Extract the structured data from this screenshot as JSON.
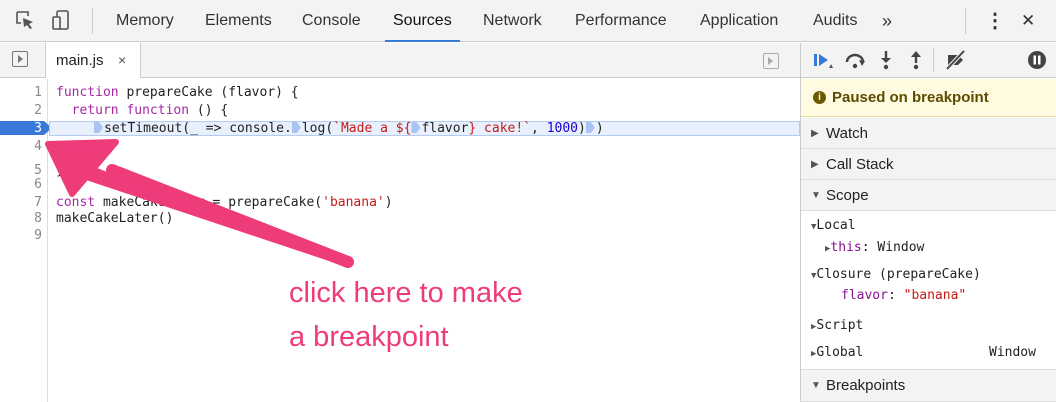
{
  "toolbar": {
    "tabs": [
      "Memory",
      "Elements",
      "Console",
      "Sources",
      "Network",
      "Performance",
      "Application",
      "Audits"
    ],
    "active_tab": "Sources",
    "overflow": "»",
    "kebab": "⋮",
    "close": "✕"
  },
  "editor": {
    "file_tab": {
      "name": "main.js",
      "close": "×"
    },
    "line_numbers": [
      "1",
      "2",
      "3",
      "4",
      "5",
      "6",
      "7",
      "8",
      "9"
    ],
    "breakpoint_line": 3,
    "code": {
      "l1_kw": "function",
      "l1_rest": " prepareCake (flavor) {",
      "l2_indent": "  ",
      "l2_kw1": "return",
      "l2_sp": " ",
      "l2_kw2": "function",
      "l2_rest": " () {",
      "l3_a": "setTimeout(_ => console.",
      "l3_b": "log(",
      "l3_str1": "`Made a ${",
      "l3_c": "flavor",
      "l3_str2": "} cake!`",
      "l3_d": ", ",
      "l3_num": "1000",
      "l3_e": ")",
      "l3_f": ")",
      "l5": "}",
      "l7_kw": "const",
      "l7_rest": " makeCakeLater = prepareCake(",
      "l7_str": "'banana'",
      "l7_end": ")",
      "l8": "makeCakeLater()"
    },
    "annotation_line1": "click here to make",
    "annotation_line2": "a breakpoint"
  },
  "debugger": {
    "paused_icon": "i",
    "paused_text": "Paused on breakpoint",
    "sections": {
      "watch": "Watch",
      "call_stack": "Call Stack",
      "scope": "Scope",
      "breakpoints": "Breakpoints"
    },
    "scope": {
      "local": "Local",
      "this_key": "this",
      "this_val": "Window",
      "closure": "Closure (prepareCake)",
      "flavor_key": "flavor",
      "flavor_val": "\"banana\"",
      "script": "Script",
      "global": "Global",
      "global_val": "Window"
    },
    "tri_open": "▼",
    "tri_closed": "▶"
  },
  "colors": {
    "accent": "#3879d9",
    "annotation": "#ee3b7a",
    "paused_bg": "#fffbe0"
  }
}
